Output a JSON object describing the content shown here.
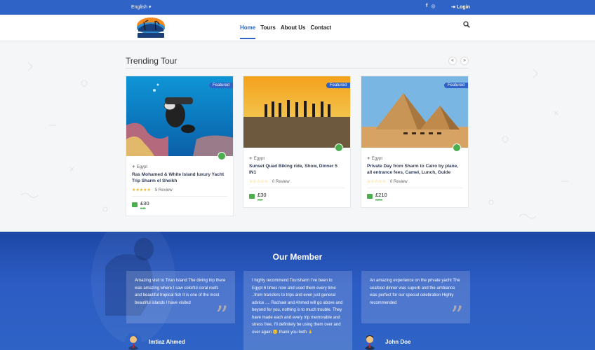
{
  "topbar": {
    "language": "English ▾",
    "social": [
      "f",
      "◎"
    ],
    "login": "Login"
  },
  "header": {
    "logo_text": "SHARMTOUR",
    "nav": [
      "Home",
      "Tours",
      "About Us",
      "Contact"
    ],
    "active_nav": "Home"
  },
  "trending": {
    "title": "Trending Tour",
    "prev": "«",
    "next": "»",
    "cards": [
      {
        "badge": "Featured",
        "location": "Egypt",
        "title": "Ras Mohamed & White Island luxury Yacht Trip Sharm el Sheikh",
        "stars": "★★★★★",
        "reviews": "5 Review",
        "price": "£30",
        "old_price": "£45"
      },
      {
        "badge": "Featured",
        "location": "Egypt",
        "title": "Sunset Quad Biking ride, Show, Dinner 5 IN1",
        "stars": "☆☆☆☆☆",
        "reviews": "0 Review",
        "price": "£30",
        "old_price": "£50"
      },
      {
        "badge": "Featured",
        "location": "Egypt",
        "title": "Private Day from Sharm to Cairo by plane, all entrance fees, Camel, Lunch, Guide",
        "stars": "☆☆☆☆☆",
        "reviews": "0 Review",
        "price": "£210",
        "old_price": "£250"
      }
    ]
  },
  "members": {
    "title": "Our Member",
    "testimonials": [
      {
        "text": "Amazing visit to Tiran Island The diving trip there was amazing where I saw colorful coral reefs and beautiful tropical fish It is one of the most beautiful islands I have visited",
        "name": "Imtiaz Ahmed"
      },
      {
        "text": "I highly recommend Toursharm I've been to Egypt 6 times now and used them every time ..from transfers to trips and even just general advice .... Rachael and Ahmed will go above and beyond for you, nothing is to much trouble. They have made each and every trip memorable and stress free, I'll definitely be using them over and over again 😊 thank you both 🙏",
        "name": ""
      },
      {
        "text": "An amazing experience on the private yacht The seafood dinner was superb and the ambiance was perfect for our special celebration Highly recommended",
        "name": "John Doe"
      }
    ]
  },
  "colors": {
    "brand_blue": "#2f63c5",
    "accent_green": "#4cae4f"
  }
}
